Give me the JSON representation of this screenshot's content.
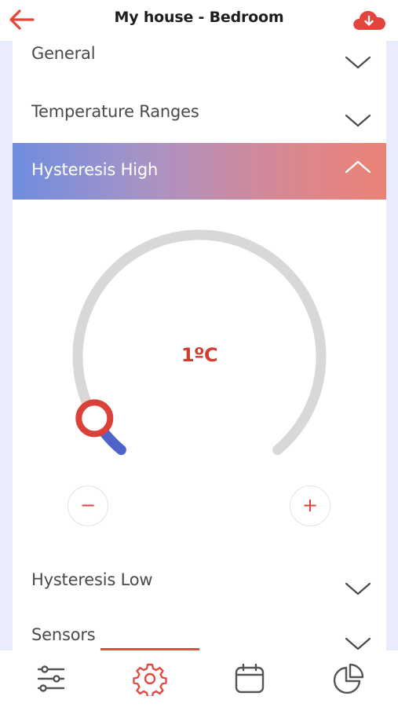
{
  "header": {
    "title": "My house - Bedroom",
    "back_icon": "arrow-left-icon",
    "cloud_icon": "cloud-download-icon",
    "accent_color": "#e2453c"
  },
  "sections": {
    "general": "General",
    "temperature_ranges": "Temperature Ranges",
    "hysteresis_high": "Hysteresis High",
    "hysteresis_low": "Hysteresis Low",
    "sensors": "Sensors"
  },
  "dial": {
    "value_label": "1ºC",
    "level_fraction": 0.07,
    "decrement_label": "−",
    "increment_label": "+",
    "track_color": "#d8d8d8",
    "fill_color": "#4f63c9",
    "value_color": "#d23a32"
  },
  "bottom_nav": {
    "items": [
      "sliders-icon",
      "gear-icon",
      "calendar-icon",
      "pie-chart-icon"
    ],
    "active": "gear-icon",
    "active_color": "#e04b43"
  }
}
